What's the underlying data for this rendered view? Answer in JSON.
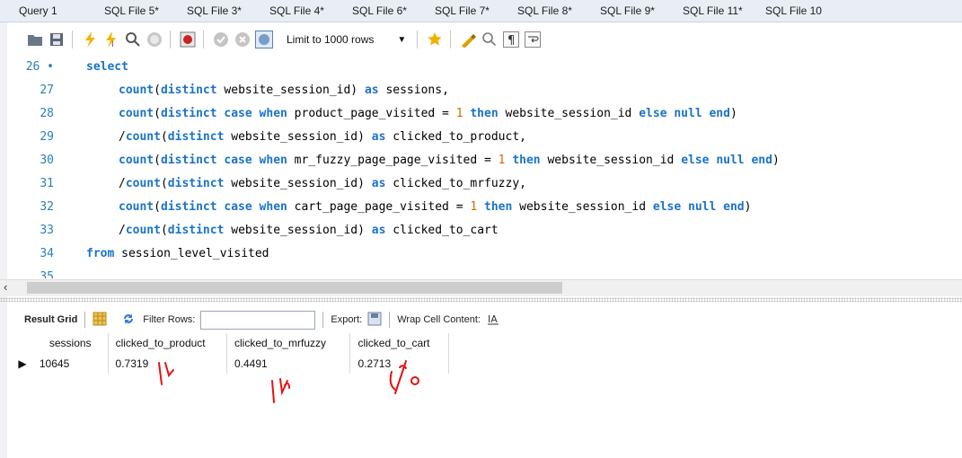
{
  "tabs": [
    "Query 1",
    "SQL File 5*",
    "SQL File 3*",
    "SQL File 4*",
    "SQL File 6*",
    "SQL File 7*",
    "SQL File 8*",
    "SQL File 9*",
    "SQL File 11*",
    "SQL File 10"
  ],
  "toolbar": {
    "limit_label": "Limit to 1000 rows",
    "icons": [
      "open-folder-icon",
      "save-icon",
      "execute-icon",
      "execute-selection-icon",
      "explain-icon",
      "stop-icon",
      "toggle-errors-icon",
      "commit-icon",
      "rollback-icon",
      "autocommit-icon",
      "add-snippet-icon",
      "beautify-icon",
      "find-icon",
      "invisible-chars-icon",
      "wrap-icon"
    ]
  },
  "editor": {
    "lines": [
      {
        "n": "26 •",
        "code": [
          {
            "t": "select",
            "k": "kw"
          }
        ],
        "indent": 0
      },
      {
        "n": "27",
        "code": [
          {
            "t": "count",
            "k": "kw"
          },
          {
            "t": "("
          },
          {
            "t": "distinct",
            "k": "kw"
          },
          {
            "t": " website_session_id) "
          },
          {
            "t": "as",
            "k": "kw"
          },
          {
            "t": " sessions,"
          }
        ],
        "indent": 1
      },
      {
        "n": "28",
        "code": [
          {
            "t": "count",
            "k": "kw"
          },
          {
            "t": "("
          },
          {
            "t": "distinct case when",
            "k": "kw"
          },
          {
            "t": " product_page_visited = "
          },
          {
            "t": "1",
            "k": "num"
          },
          {
            "t": " "
          },
          {
            "t": "then",
            "k": "kw"
          },
          {
            "t": " website_session_id "
          },
          {
            "t": "else null end",
            "k": "kw"
          },
          {
            "t": ")"
          }
        ],
        "indent": 1
      },
      {
        "n": "29",
        "code": [
          {
            "t": "/"
          },
          {
            "t": "count",
            "k": "kw"
          },
          {
            "t": "("
          },
          {
            "t": "distinct",
            "k": "kw"
          },
          {
            "t": " website_session_id) "
          },
          {
            "t": "as",
            "k": "kw"
          },
          {
            "t": " clicked_to_product,"
          }
        ],
        "indent": 1
      },
      {
        "n": "30",
        "code": [
          {
            "t": "count",
            "k": "kw"
          },
          {
            "t": "("
          },
          {
            "t": "distinct case when",
            "k": "kw"
          },
          {
            "t": " mr_fuzzy_page_page_visited = "
          },
          {
            "t": "1",
            "k": "num"
          },
          {
            "t": " "
          },
          {
            "t": "then",
            "k": "kw"
          },
          {
            "t": " website_session_id "
          },
          {
            "t": "else null end",
            "k": "kw"
          },
          {
            "t": ")"
          }
        ],
        "indent": 1
      },
      {
        "n": "31",
        "code": [
          {
            "t": "/"
          },
          {
            "t": "count",
            "k": "kw"
          },
          {
            "t": "("
          },
          {
            "t": "distinct",
            "k": "kw"
          },
          {
            "t": " website_session_id) "
          },
          {
            "t": "as",
            "k": "kw"
          },
          {
            "t": " clicked_to_mrfuzzy,"
          }
        ],
        "indent": 1
      },
      {
        "n": "32",
        "code": [
          {
            "t": "count",
            "k": "kw"
          },
          {
            "t": "("
          },
          {
            "t": "distinct case when",
            "k": "kw"
          },
          {
            "t": " cart_page_page_visited = "
          },
          {
            "t": "1",
            "k": "num"
          },
          {
            "t": " "
          },
          {
            "t": "then",
            "k": "kw"
          },
          {
            "t": " website_session_id "
          },
          {
            "t": "else null end",
            "k": "kw"
          },
          {
            "t": ")"
          }
        ],
        "indent": 1
      },
      {
        "n": "33",
        "code": [
          {
            "t": "/"
          },
          {
            "t": "count",
            "k": "kw"
          },
          {
            "t": "("
          },
          {
            "t": "distinct",
            "k": "kw"
          },
          {
            "t": " website_session_id) "
          },
          {
            "t": "as",
            "k": "kw"
          },
          {
            "t": " clicked_to_cart"
          }
        ],
        "indent": 1
      },
      {
        "n": "34",
        "code": [
          {
            "t": "from",
            "k": "kw"
          },
          {
            "t": " session_level_visited"
          }
        ],
        "indent": 0
      },
      {
        "n": "35",
        "code": [],
        "indent": 0
      }
    ]
  },
  "results": {
    "grid_label": "Result Grid",
    "filter_label": "Filter Rows:",
    "export_label": "Export:",
    "wrap_label": "Wrap Cell Content:",
    "columns": [
      "sessions",
      "clicked_to_product",
      "clicked_to_mrfuzzy",
      "clicked_to_cart"
    ],
    "rows": [
      [
        "10645",
        "0.7319",
        "0.4491",
        "0.2713"
      ]
    ]
  }
}
